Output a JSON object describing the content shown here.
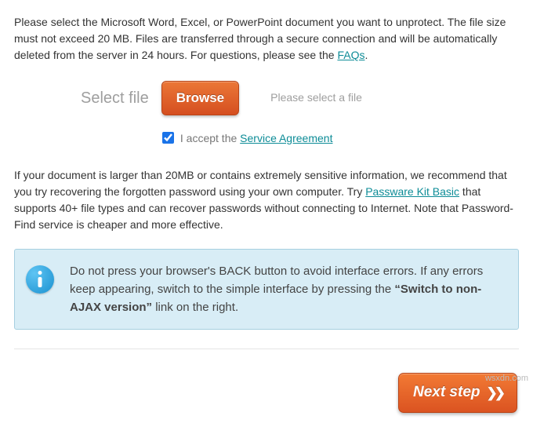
{
  "intro": {
    "text_before_link": "Please select the Microsoft Word, Excel, or PowerPoint document you want to unprotect. The file size must not exceed 20 MB. Files are transferred through a secure connection and will be automatically deleted from the server in 24 hours. For questions, please see the ",
    "link_label": "FAQs",
    "text_after_link": "."
  },
  "select": {
    "label": "Select file",
    "browse_label": "Browse",
    "hint": "Please select a file"
  },
  "agreement": {
    "prefix": "I accept the ",
    "link_label": "Service Agreement",
    "checked": true
  },
  "paragraph2": {
    "before_link": "If your document is larger than 20MB or contains extremely sensitive information, we recommend that you try recovering the forgotten password using your own computer. Try ",
    "link_label": "Passware Kit Basic",
    "after_link": " that supports 40+ file types and can recover passwords without connecting to Internet. Note that Password-Find service is cheaper and more effective."
  },
  "info": {
    "part1": "Do not press your browser's BACK button to avoid interface errors. If any errors keep appearing, switch to the simple interface by pressing the ",
    "bold": "“Switch to non-AJAX version”",
    "part2": " link on the right."
  },
  "next_label": "Next step",
  "watermark": "wsxdn.com"
}
